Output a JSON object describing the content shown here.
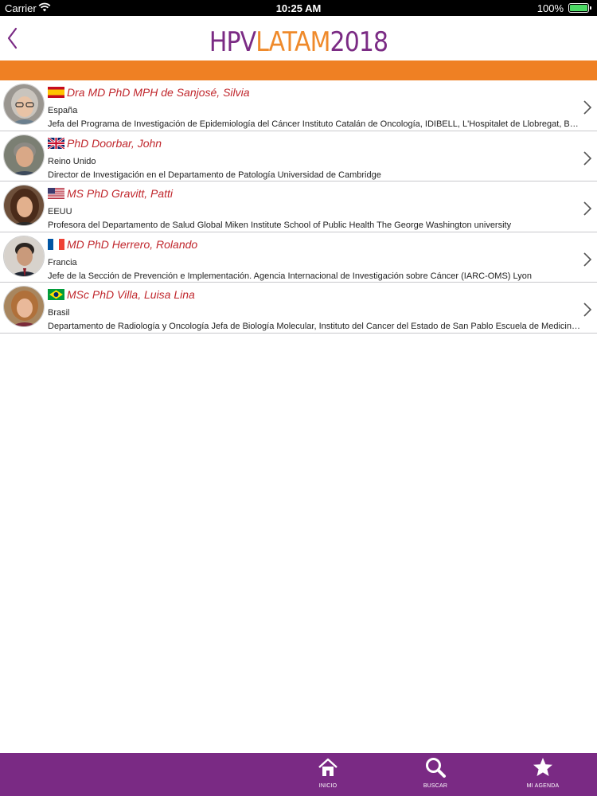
{
  "status_bar": {
    "carrier": "Carrier",
    "time": "10:25 AM",
    "battery": "100%"
  },
  "header": {
    "logo_hpv": "HPV",
    "logo_latam": "LATAM",
    "logo_year": "2018",
    "accent_color": "#ef8023",
    "brand_color": "#7a2a84"
  },
  "speakers": [
    {
      "name": "Dra MD PhD MPH de Sanjosé, Silvia",
      "country": "España",
      "flag": "spain-flag",
      "description": "Jefa del Programa de Investigación de Epidemiología del Cáncer Instituto Catalán de Oncología, IDIBELL, L'Hospitalet de Llobregat, Barcelona"
    },
    {
      "name": "PhD Doorbar, John",
      "country": "Reino Unido",
      "flag": "uk-flag",
      "description": "Director de Investigación en el Departamento de Patología Universidad de Cambridge"
    },
    {
      "name": "MS PhD Gravitt, Patti",
      "country": "EEUU",
      "flag": "usa-flag",
      "description": "Profesora del Departamento de Salud Global Miken Institute School of Public Health The George Washington university"
    },
    {
      "name": "MD PhD Herrero, Rolando",
      "country": "Francia",
      "flag": "france-flag",
      "description": "Jefe de la Sección de Prevención e Implementación. Agencia Internacional de Investigación sobre Cáncer (IARC-OMS) Lyon"
    },
    {
      "name": "MSc PhD Villa, Luisa Lina",
      "country": "Brasil",
      "flag": "brazil-flag",
      "description": "Departamento de Radiología y Oncología Jefa de Biología Molecular, Instituto del Cancer del Estado de San Pablo Escuela de Medicina, Universidad de São Paulo"
    }
  ],
  "tab_bar": {
    "inicio": "INICIO",
    "buscar": "BUSCAR",
    "agenda": "MI AGENDA"
  }
}
